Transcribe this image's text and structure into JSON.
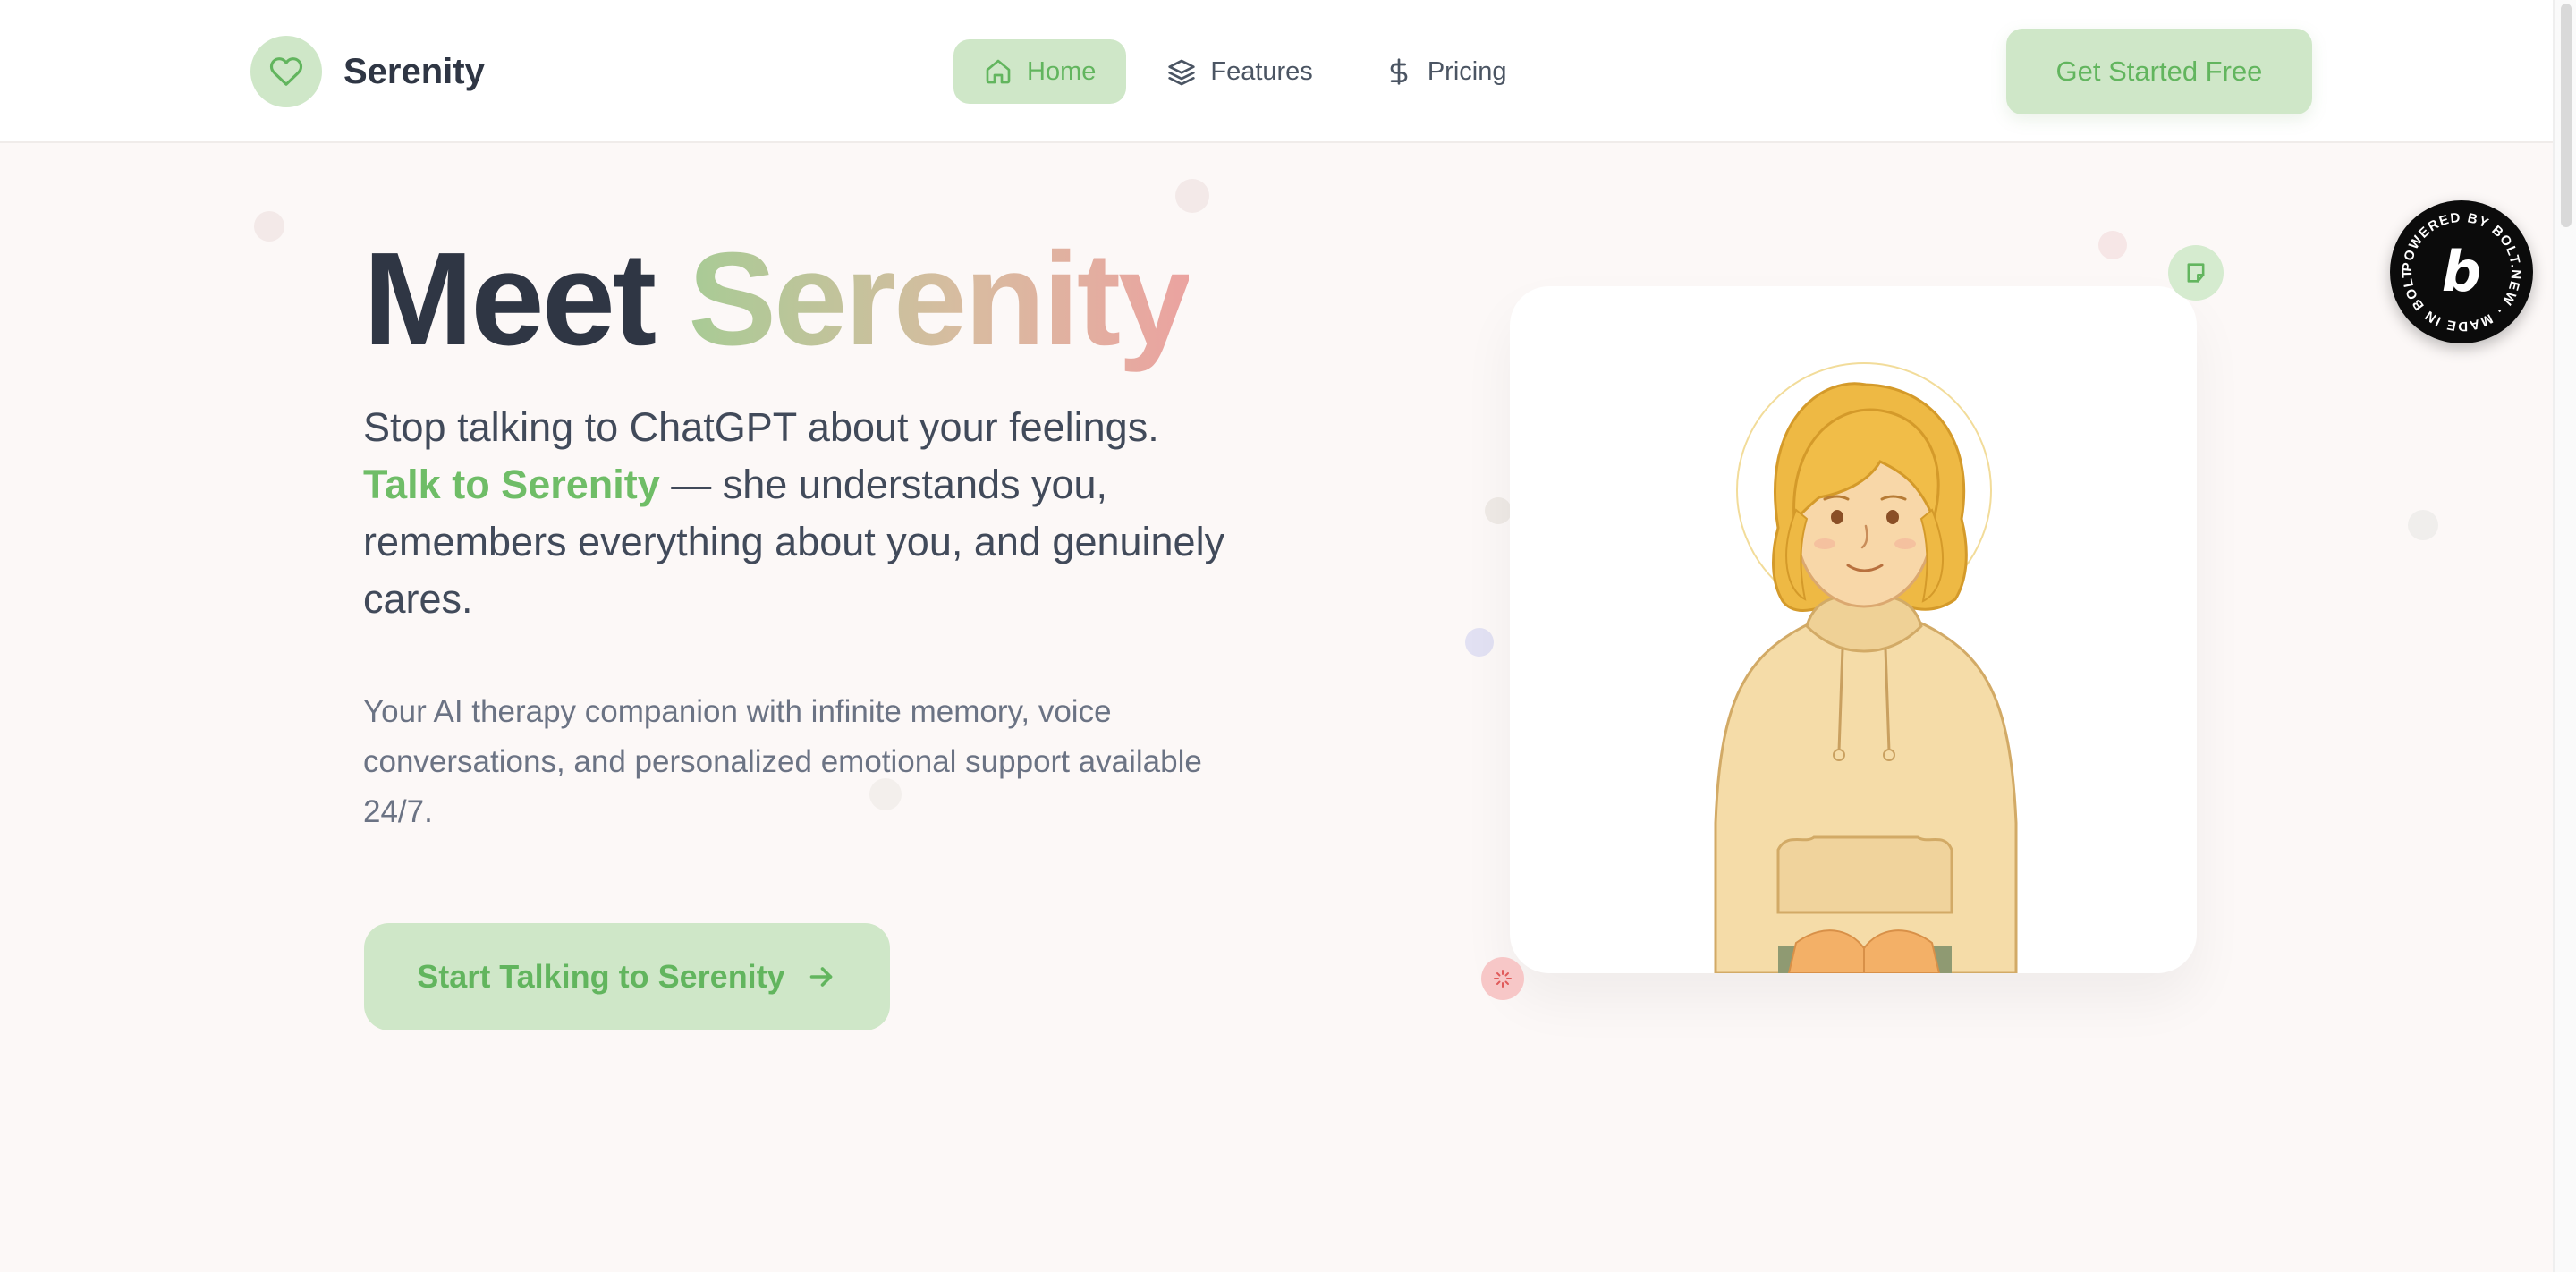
{
  "brand": {
    "name": "Serenity",
    "logo_icon": "heart-icon"
  },
  "nav": {
    "items": [
      {
        "label": "Home",
        "icon": "home-icon",
        "active": true
      },
      {
        "label": "Features",
        "icon": "layers-icon",
        "active": false
      },
      {
        "label": "Pricing",
        "icon": "dollar-icon",
        "active": false
      }
    ]
  },
  "header": {
    "cta_label": "Get Started Free"
  },
  "hero": {
    "title_part1": "Meet",
    "title_part2": "Serenity",
    "lead_line1": "Stop talking to ChatGPT about your feelings.",
    "lead_accent": "Talk to Serenity",
    "lead_rest": " — she understands you, remembers everything about you, and genuinely cares.",
    "sub": "Your AI therapy companion with infinite memory, voice conversations, and personalized emotional support available 24/7.",
    "cta_label": "Start Talking to Serenity"
  },
  "badge": {
    "text": "POWERED BY BOLT.NEW · MADE IN BOLT.NEW · ",
    "letter": "b"
  },
  "colors": {
    "accent": "#62b55e",
    "accent_soft": "#cfe7c8",
    "text_dark": "#2f3644",
    "gradient_end": "#eba3a0"
  }
}
